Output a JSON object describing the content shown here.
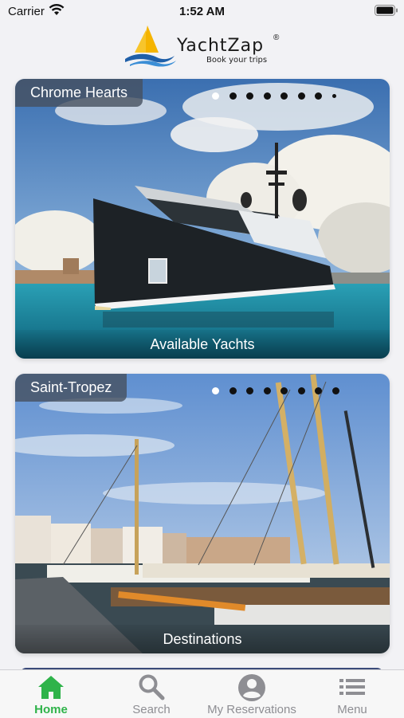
{
  "status_bar": {
    "carrier": "Carrier",
    "time": "1:52 AM"
  },
  "brand": {
    "name": "YachtZap",
    "registered": "®",
    "tagline": "Book your trips"
  },
  "cards": [
    {
      "tag": "Chrome Hearts",
      "caption": "Available Yachts",
      "dots_active_index": 0,
      "dots_count": 8
    },
    {
      "tag": "Saint-Tropez",
      "caption": "Destinations",
      "dots_active_index": 0,
      "dots_count": 8
    }
  ],
  "tab_bar": {
    "items": [
      {
        "label": "Home",
        "icon": "home-icon",
        "active": true
      },
      {
        "label": "Search",
        "icon": "search-icon",
        "active": false
      },
      {
        "label": "My Reservations",
        "icon": "account-icon",
        "active": false
      },
      {
        "label": "Menu",
        "icon": "menu-icon",
        "active": false
      }
    ]
  },
  "colors": {
    "accent": "#2fb34a",
    "inactive": "#8e8e93",
    "background": "#f2f2f5"
  }
}
